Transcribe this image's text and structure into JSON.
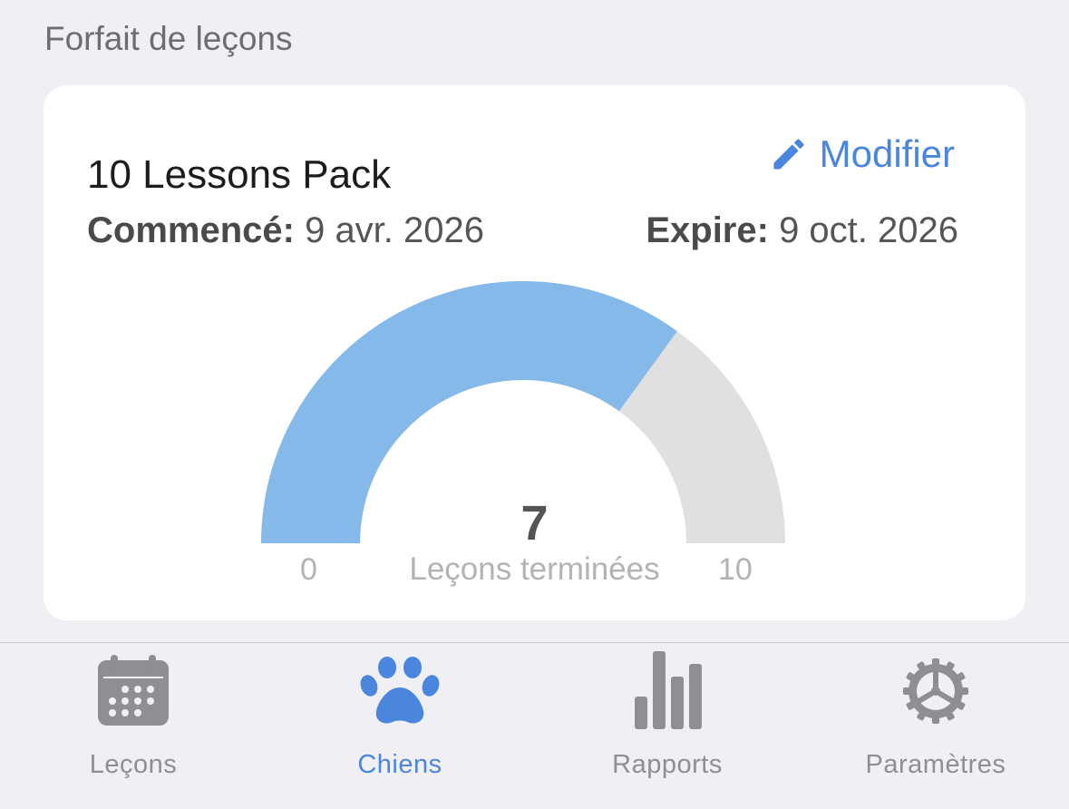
{
  "section": {
    "title": "Forfait de leçons"
  },
  "card": {
    "pack_name": "10 Lessons Pack",
    "edit_label": "Modifier",
    "started_label": "Commencé:",
    "started_value": "9 avr. 2026",
    "expires_label": "Expire:",
    "expires_value": "9 oct. 2026"
  },
  "gauge": {
    "value": 7,
    "value_text": "7",
    "min": 0,
    "max": 10,
    "min_text": "0",
    "max_text": "10",
    "caption": "Leçons terminées",
    "fill_color": "#85b9ea",
    "track_color": "#e0e0e0"
  },
  "tabbar": {
    "items": [
      {
        "label": "Leçons",
        "icon": "calendar-icon",
        "active": false
      },
      {
        "label": "Chiens",
        "icon": "paw-icon",
        "active": true
      },
      {
        "label": "Rapports",
        "icon": "bar-chart-icon",
        "active": false
      },
      {
        "label": "Paramètres",
        "icon": "gear-icon",
        "active": false
      }
    ]
  },
  "colors": {
    "accent": "#4a86dd",
    "inactive": "#8e8e93",
    "background": "#efeff4"
  }
}
